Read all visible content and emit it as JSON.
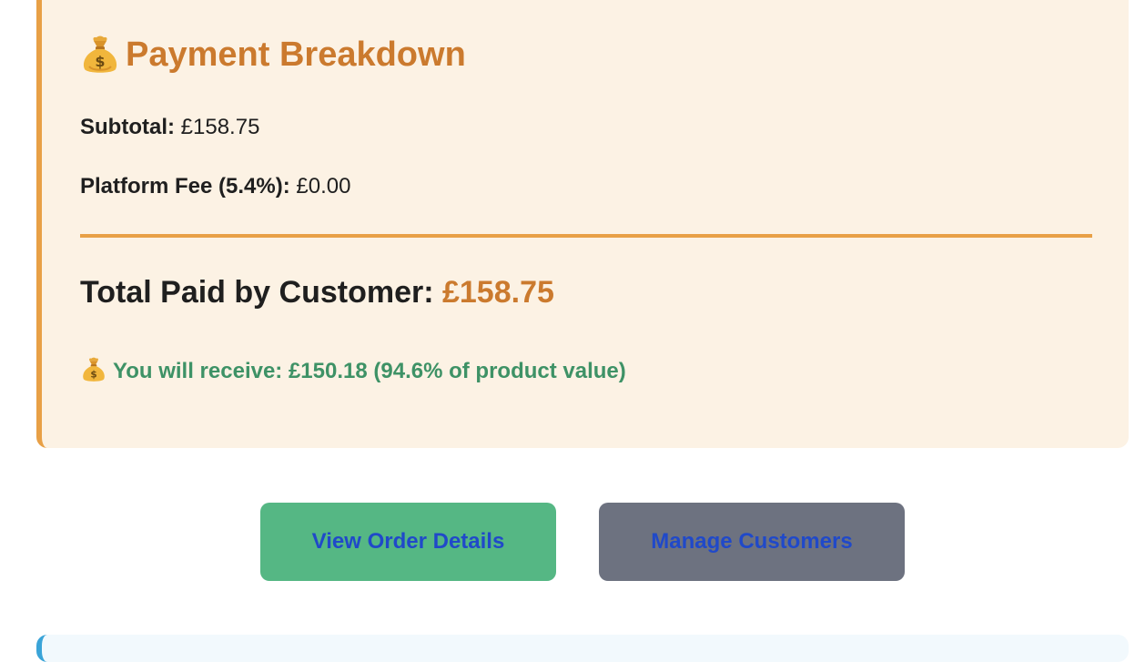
{
  "payment_breakdown": {
    "title": "Payment Breakdown",
    "title_icon": "money-bag-icon",
    "subtotal_label": "Subtotal:",
    "subtotal_value": "£158.75",
    "fee_label": "Platform Fee (5.4%):",
    "fee_value": "£0.00",
    "total_label": "Total Paid by Customer:",
    "total_value": "£158.75",
    "receive_icon": "money-bag-icon",
    "receive_text": "You will receive: £150.18 (94.6% of product value)"
  },
  "actions": {
    "view_order_label": "View Order Details",
    "manage_customers_label": "Manage Customers"
  },
  "colors": {
    "card_background": "#fcf2e4",
    "accent_orange": "#cb7a2e",
    "border_orange": "#e8a046",
    "receive_green": "#3e9266",
    "view_button_green": "#55b784",
    "manage_button_gray": "#6d7280",
    "button_text_blue": "#2049c9"
  }
}
